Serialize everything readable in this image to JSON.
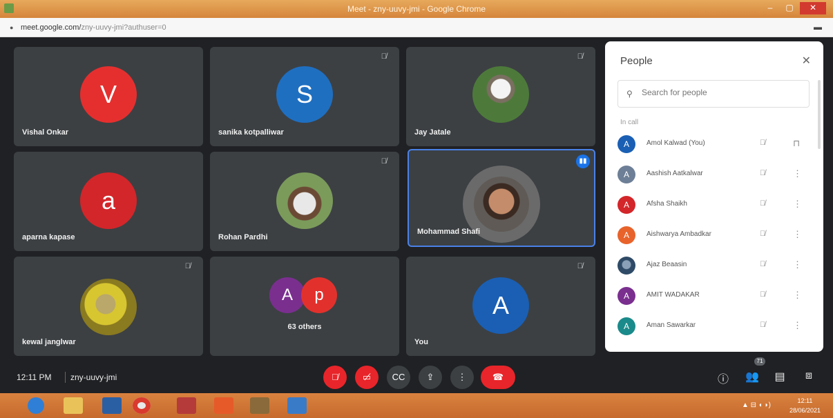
{
  "window": {
    "title": "Meet - zny-uuvy-jmi - Google Chrome",
    "url_host": "meet.google.com/",
    "url_rest": "zny-uuvy-jmi?authuser=0",
    "min_label": "–",
    "max_label": "▢",
    "close_label": "✕"
  },
  "tiles": [
    {
      "name": "Vishal Onkar",
      "initial": "V",
      "color": "#e52f2f",
      "muted": false
    },
    {
      "name": "sanika kotpalliwar",
      "initial": "S",
      "color": "#1f6fc1",
      "muted": true
    },
    {
      "name": "Jay Jatale",
      "photo": true,
      "muted": true
    },
    {
      "name": "aparna kapase",
      "initial": "a",
      "color": "#d3262a",
      "muted": false
    },
    {
      "name": "Rohan Pardhi",
      "photo": true,
      "muted": true
    },
    {
      "name": "Mohammad Shafi",
      "photo": true,
      "speaking": true
    },
    {
      "name": "kewal janglwar",
      "photo": true,
      "muted": true
    },
    {
      "name": "63 others",
      "others": [
        "A",
        "p"
      ],
      "other_colors": [
        "#7a2f8f",
        "#e2312c"
      ]
    },
    {
      "name": "You",
      "initial": "A",
      "color": "#1a5fb4",
      "muted": true
    }
  ],
  "people_panel": {
    "title": "People",
    "close": "✕",
    "search_placeholder": "Search for people",
    "section": "In call",
    "people": [
      {
        "initial": "A",
        "name": "Amol Kalwad (You)",
        "color": "#1a5fb4"
      },
      {
        "initial": "A",
        "name": "Aashish Aatkalwar",
        "color": "#6d7f96"
      },
      {
        "initial": "A",
        "name": "Afsha Shaikh",
        "color": "#d3262a"
      },
      {
        "initial": "A",
        "name": "Aishwarya Ambadkar",
        "color": "#e8632c"
      },
      {
        "initial": "",
        "name": "Ajaz Beaasin",
        "color": "#4a6a8a"
      },
      {
        "initial": "A",
        "name": "AMIT WADAKAR",
        "color": "#7a2f8f"
      },
      {
        "initial": "A",
        "name": "Aman Sawarkar",
        "color": "#1b8a8a"
      }
    ]
  },
  "bottom": {
    "time": "12:11 PM",
    "meeting_code": "zny-uuvy-jmi",
    "people_count": "71"
  },
  "taskbar": {
    "clock_time": "12:11",
    "clock_date": "28/06/2021"
  }
}
